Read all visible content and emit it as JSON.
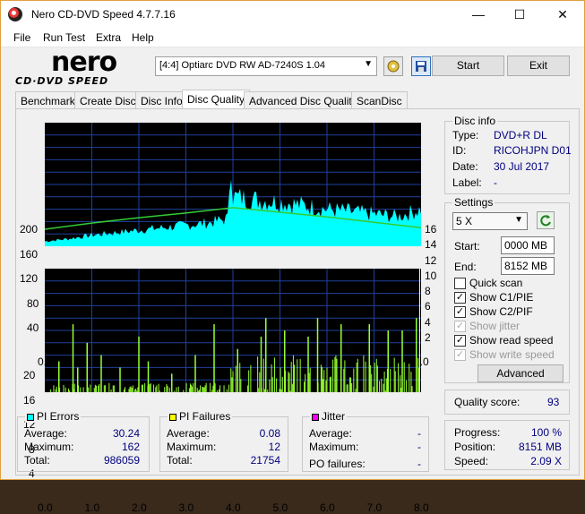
{
  "window": {
    "title": "Nero CD-DVD Speed 4.7.7.16",
    "minimize": "—",
    "maximize": "☐",
    "close": "✕"
  },
  "menu": [
    "File",
    "Run Test",
    "Extra",
    "Help"
  ],
  "logo": {
    "nero": "nero",
    "sub": "CD·DVD SPEED"
  },
  "drive": {
    "selected": "[4:4]  Optiarc DVD RW AD-7240S 1.04"
  },
  "buttons": {
    "start": "Start",
    "exit": "Exit",
    "advanced": "Advanced"
  },
  "tabs": [
    "Benchmark",
    "Create Disc",
    "Disc Info",
    "Disc Quality",
    "Advanced Disc Quality",
    "ScanDisc"
  ],
  "active_tab": "Disc Quality",
  "disc_info": {
    "title": "Disc info",
    "type_label": "Type:",
    "type": "DVD+R DL",
    "id_label": "ID:",
    "id": "RICOHJPN D01",
    "date_label": "Date:",
    "date": "30 Jul 2017",
    "label_label": "Label:",
    "label": "-"
  },
  "settings": {
    "title": "Settings",
    "speed": "5 X",
    "start_label": "Start:",
    "start": "0000 MB",
    "end_label": "End:",
    "end": "8152 MB",
    "quick_scan": "Quick scan",
    "show_c1": "Show C1/PIE",
    "show_c2": "Show C2/PIF",
    "show_jitter": "Show jitter",
    "show_read": "Show read speed",
    "show_write": "Show write speed"
  },
  "quality": {
    "label": "Quality score:",
    "value": "93"
  },
  "progress": {
    "progress_label": "Progress:",
    "progress": "100 %",
    "position_label": "Position:",
    "position": "8151 MB",
    "speed_label": "Speed:",
    "speed": "2.09 X"
  },
  "pi_errors": {
    "title": "PI Errors",
    "avg_label": "Average:",
    "avg": "30.24",
    "max_label": "Maximum:",
    "max": "162",
    "total_label": "Total:",
    "total": "986059",
    "color": "#00ffff"
  },
  "pi_failures": {
    "title": "PI Failures",
    "avg_label": "Average:",
    "avg": "0.08",
    "max_label": "Maximum:",
    "max": "12",
    "total_label": "Total:",
    "total": "21754",
    "color": "#ffff00"
  },
  "jitter": {
    "title": "Jitter",
    "avg_label": "Average:",
    "avg": "-",
    "max_label": "Maximum:",
    "max": "-",
    "po_label": "PO failures:",
    "po": "-",
    "color": "#ff00ff"
  },
  "chart_data": [
    {
      "type": "area",
      "x_ticks": [
        "0.0",
        "1.0",
        "2.0",
        "3.0",
        "4.0",
        "5.0",
        "6.0",
        "7.0",
        "8.0"
      ],
      "y_ticks_left": [
        "200",
        "160",
        "120",
        "80",
        "40"
      ],
      "y_ticks_right": [
        "16",
        "14",
        "12",
        "10",
        "8",
        "6",
        "4",
        "2"
      ],
      "xlim": [
        0,
        8
      ],
      "ylim": [
        0,
        200
      ],
      "y2lim": [
        0,
        16
      ],
      "series": [
        {
          "values_x": [
            0.0,
            0.5,
            1.0,
            1.5,
            2.0,
            2.5,
            3.0,
            3.5,
            3.9,
            3.95,
            4.0,
            4.5,
            5.0,
            5.5,
            6.0,
            6.5,
            7.0,
            7.5,
            8.0
          ],
          "values": [
            8,
            12,
            18,
            22,
            26,
            30,
            34,
            38,
            45,
            160,
            80,
            75,
            72,
            66,
            60,
            56,
            52,
            48,
            60
          ],
          "color": "#00ffff"
        },
        {
          "values_x": [
            0.0,
            1.0,
            2.0,
            3.0,
            4.0,
            5.0,
            6.0,
            7.0,
            8.0
          ],
          "values": [
            2.2,
            3.0,
            3.7,
            4.3,
            5.0,
            4.4,
            3.8,
            3.1,
            2.4
          ],
          "color": "#33cc33"
        }
      ]
    },
    {
      "type": "bar",
      "x_ticks": [
        "0.0",
        "1.0",
        "2.0",
        "3.0",
        "4.0",
        "5.0",
        "6.0",
        "7.0",
        "8.0"
      ],
      "y_ticks_left": [
        "20",
        "16",
        "12",
        "8",
        "4"
      ],
      "xlim": [
        0,
        8
      ],
      "ylim": [
        0,
        20
      ],
      "series": [
        {
          "values_x": [
            0.3,
            0.6,
            0.7,
            0.9,
            1.2,
            1.6,
            2.0,
            2.2,
            2.7,
            3.2,
            3.6,
            4.1,
            4.6,
            4.7,
            5.1,
            5.6,
            5.8,
            6.3,
            6.9,
            7.3,
            7.6,
            7.9
          ],
          "values": [
            5,
            11,
            4,
            8,
            6,
            4,
            9,
            5,
            3,
            6,
            11,
            7,
            9,
            12,
            10,
            9,
            12,
            11,
            11,
            10,
            10,
            12
          ],
          "color": "#99ff33"
        }
      ]
    }
  ]
}
